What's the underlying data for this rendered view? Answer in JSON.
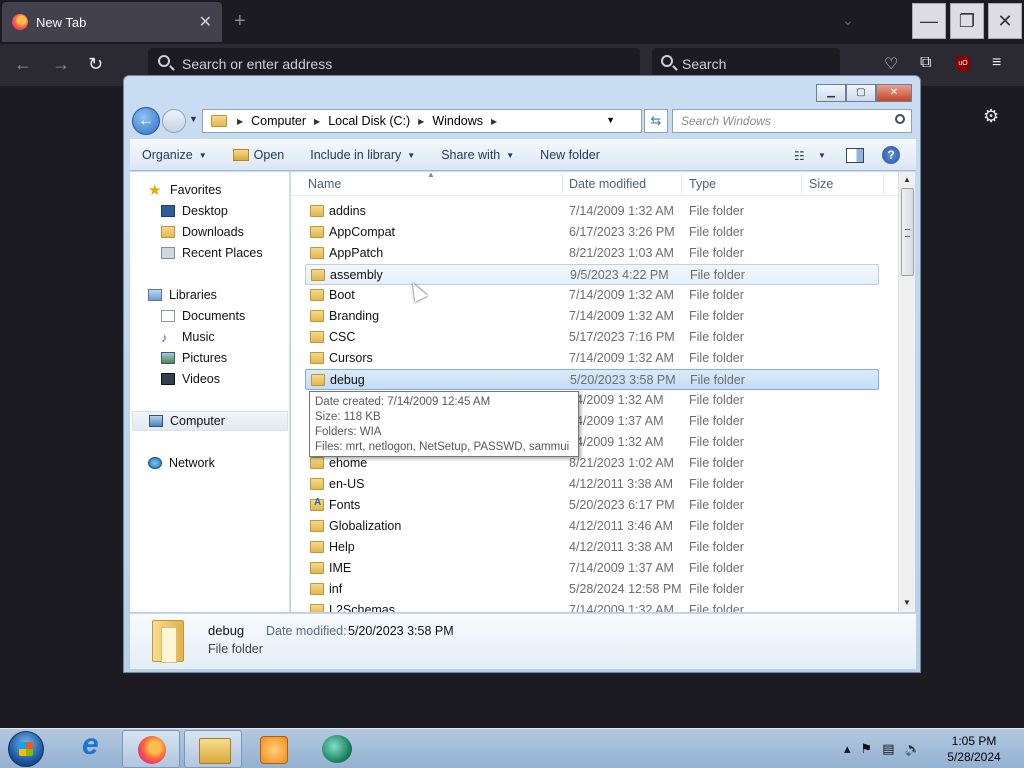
{
  "browser": {
    "tab_title": "New Tab",
    "tab_close": "✕",
    "new_tab": "+",
    "address_placeholder": "Search or enter address",
    "search_placeholder": "Search"
  },
  "explorer": {
    "breadcrumb": [
      "Computer",
      "Local Disk (C:)",
      "Windows"
    ],
    "search_placeholder": "Search Windows",
    "commands": {
      "organize": "Organize",
      "open": "Open",
      "include": "Include in library",
      "share": "Share with",
      "new_folder": "New folder"
    },
    "nav": {
      "favorites": "Favorites",
      "desktop": "Desktop",
      "downloads": "Downloads",
      "recent": "Recent Places",
      "libraries": "Libraries",
      "documents": "Documents",
      "music": "Music",
      "pictures": "Pictures",
      "videos": "Videos",
      "computer": "Computer",
      "network": "Network"
    },
    "columns": {
      "name": "Name",
      "date": "Date modified",
      "type": "Type",
      "size": "Size"
    },
    "files": [
      {
        "name": "addins",
        "date": "7/14/2009 1:32 AM",
        "type": "File folder"
      },
      {
        "name": "AppCompat",
        "date": "6/17/2023 3:26 PM",
        "type": "File folder"
      },
      {
        "name": "AppPatch",
        "date": "8/21/2023 1:03 AM",
        "type": "File folder"
      },
      {
        "name": "assembly",
        "date": "9/5/2023 4:22 PM",
        "type": "File folder"
      },
      {
        "name": "Boot",
        "date": "7/14/2009 1:32 AM",
        "type": "File folder"
      },
      {
        "name": "Branding",
        "date": "7/14/2009 1:32 AM",
        "type": "File folder"
      },
      {
        "name": "CSC",
        "date": "5/17/2023 7:16 PM",
        "type": "File folder"
      },
      {
        "name": "Cursors",
        "date": "7/14/2009 1:32 AM",
        "type": "File folder"
      },
      {
        "name": "debug",
        "date": "5/20/2023 3:58 PM",
        "type": "File folder"
      },
      {
        "name": "",
        "date": "14/2009 1:32 AM",
        "type": "File folder"
      },
      {
        "name": "",
        "date": "14/2009 1:37 AM",
        "type": "File folder"
      },
      {
        "name": "",
        "date": "14/2009 1:32 AM",
        "type": "File folder"
      },
      {
        "name": "ehome",
        "date": "8/21/2023 1:02 AM",
        "type": "File folder"
      },
      {
        "name": "en-US",
        "date": "4/12/2011 3:38 AM",
        "type": "File folder"
      },
      {
        "name": "Fonts",
        "date": "5/20/2023 6:17 PM",
        "type": "File folder"
      },
      {
        "name": "Globalization",
        "date": "4/12/2011 3:46 AM",
        "type": "File folder"
      },
      {
        "name": "Help",
        "date": "4/12/2011 3:38 AM",
        "type": "File folder"
      },
      {
        "name": "IME",
        "date": "7/14/2009 1:37 AM",
        "type": "File folder"
      },
      {
        "name": "inf",
        "date": "5/28/2024 12:58 PM",
        "type": "File folder"
      },
      {
        "name": "L2Schemas",
        "date": "7/14/2009 1:32 AM",
        "type": "File folder"
      }
    ],
    "hovered_row": 3,
    "selected_row": 8,
    "tooltip": [
      "Date created: 7/14/2009 12:45 AM",
      "Size: 118 KB",
      "Folders: WIA",
      "Files: mrt, netlogon, NetSetup, PASSWD, sammui"
    ],
    "details": {
      "name": "debug",
      "type": "File folder",
      "modified_label": "Date modified:",
      "modified_value": "5/20/2023 3:58 PM"
    }
  },
  "taskbar": {
    "time": "1:05 PM",
    "date": "5/28/2024"
  },
  "colors": {
    "selection": "#c4dcf4",
    "hover": "#e6eff9",
    "browser_dark": "#1c1b22"
  }
}
